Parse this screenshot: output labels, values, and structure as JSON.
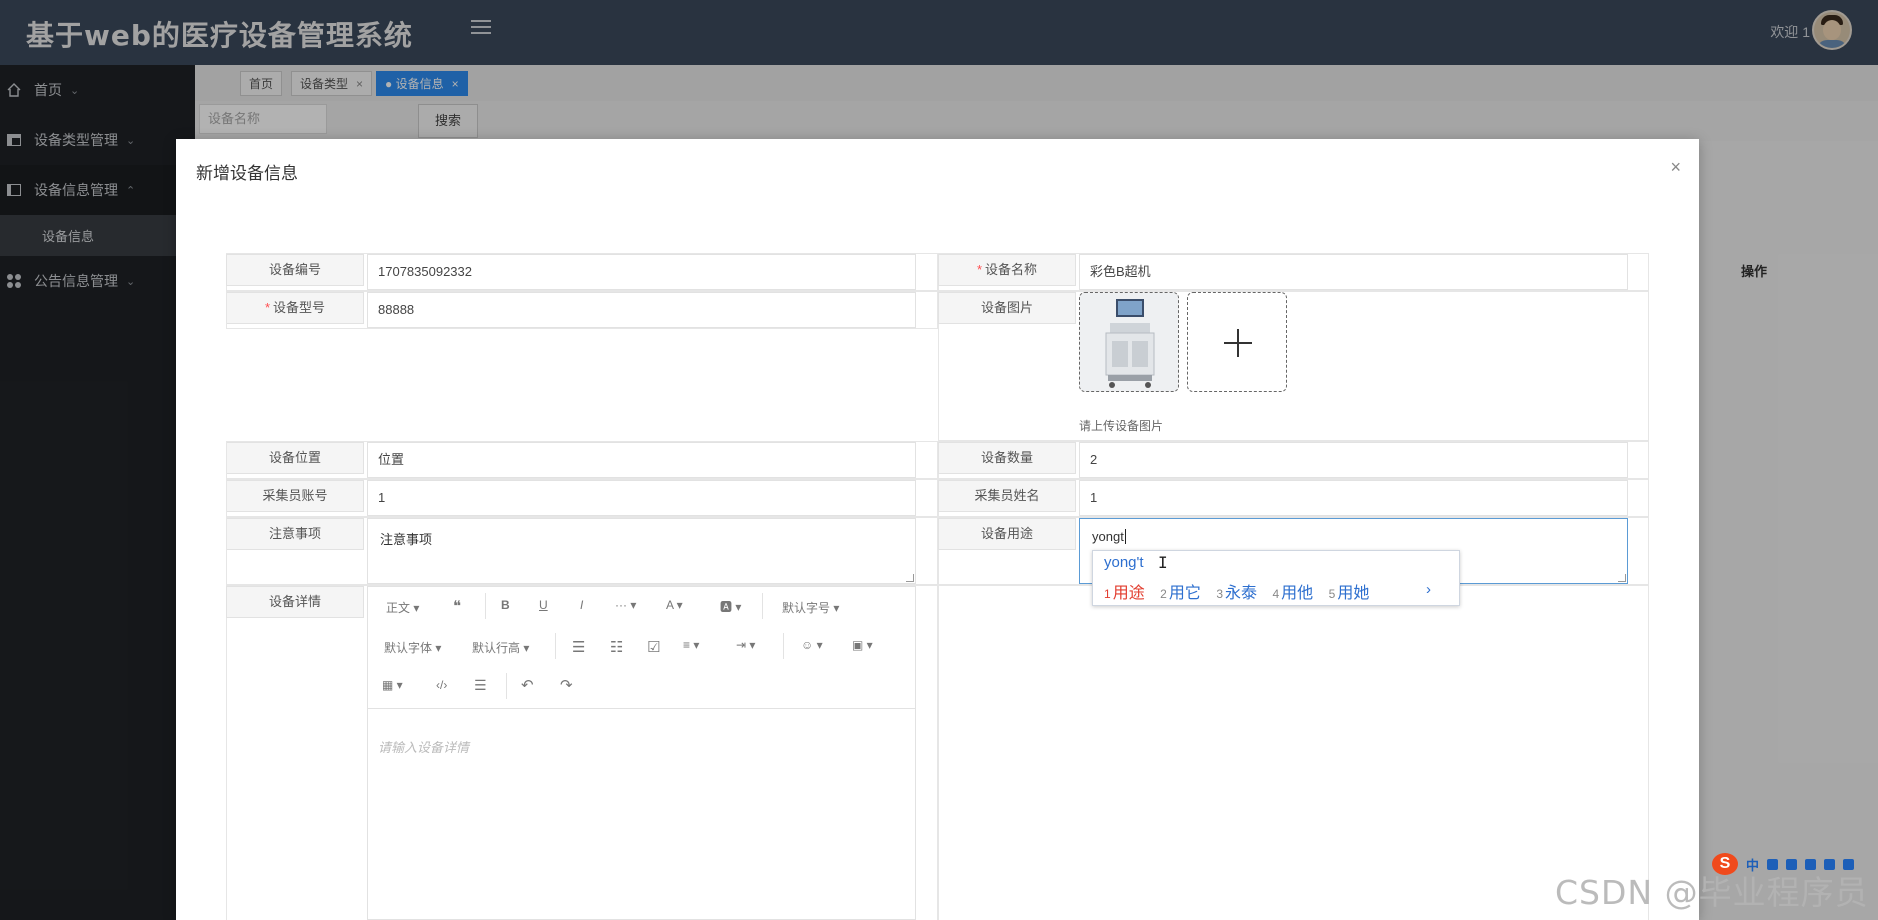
{
  "app": {
    "title": "基于web的医疗设备管理系统",
    "welcome": "欢迎 1"
  },
  "sidebar": {
    "items": [
      {
        "label": "首页",
        "icon": "home-icon"
      },
      {
        "label": "设备类型管理",
        "icon": "table-icon"
      },
      {
        "label": "设备信息管理",
        "icon": "columns-icon"
      },
      {
        "label": "公告信息管理",
        "icon": "apps-icon"
      }
    ],
    "sub_item": "设备信息"
  },
  "tabs": [
    {
      "label": "首页"
    },
    {
      "label": "设备类型",
      "close": "×"
    },
    {
      "label": "● 设备信息",
      "close": "×"
    }
  ],
  "search": {
    "placeholder": "设备名称",
    "button": "搜索"
  },
  "table": {
    "action_header": "操作"
  },
  "modal": {
    "title": "新增设备信息",
    "close": "×",
    "fields": {
      "device_no_label": "设备编号",
      "device_no_value": "1707835092332",
      "device_name_label": "设备名称",
      "device_name_value": "彩色B超机",
      "device_model_label": "设备型号",
      "device_model_value": "88888",
      "device_image_label": "设备图片",
      "device_image_hint": "请上传设备图片",
      "location_label": "设备位置",
      "location_value": "位置",
      "quantity_label": "设备数量",
      "quantity_value": "2",
      "collector_account_label": "采集员账号",
      "collector_account_value": "1",
      "collector_name_label": "采集员姓名",
      "collector_name_value": "1",
      "notes_label": "注意事项",
      "notes_value": "注意事项",
      "usage_label": "设备用途",
      "usage_value": "yongt",
      "details_label": "设备详情",
      "details_placeholder": "请输入设备详情"
    },
    "editor_toolbar": {
      "paragraph": "正文 ▾",
      "quote": "❝",
      "bold": "B",
      "underline": "U",
      "italic": "I",
      "more": "··· ▾",
      "font_color": "A ▾",
      "bg_color": "🅰 ▾",
      "font_size": "默认字号 ▾",
      "font_family": "默认字体 ▾",
      "line_height": "默认行高 ▾",
      "bullet_list": "☰",
      "number_list": "☷",
      "todo": "☑",
      "align": "≡ ▾",
      "indent": "⇥ ▾",
      "emoji": "☺ ▾",
      "image": "▣ ▾",
      "table": "▦ ▾",
      "code": "‹/›",
      "divider": "☰",
      "undo": "↶",
      "redo": "↷"
    }
  },
  "ime": {
    "composition": "yong't",
    "candidates": [
      {
        "n": "1",
        "text": "用途"
      },
      {
        "n": "2",
        "text": "用它"
      },
      {
        "n": "3",
        "text": "永泰"
      },
      {
        "n": "4",
        "text": "用他"
      },
      {
        "n": "5",
        "text": "用她"
      }
    ],
    "next": "›",
    "tray_logo": "S",
    "tray_lang": "中"
  },
  "watermark": "CSDN @毕业程序员"
}
